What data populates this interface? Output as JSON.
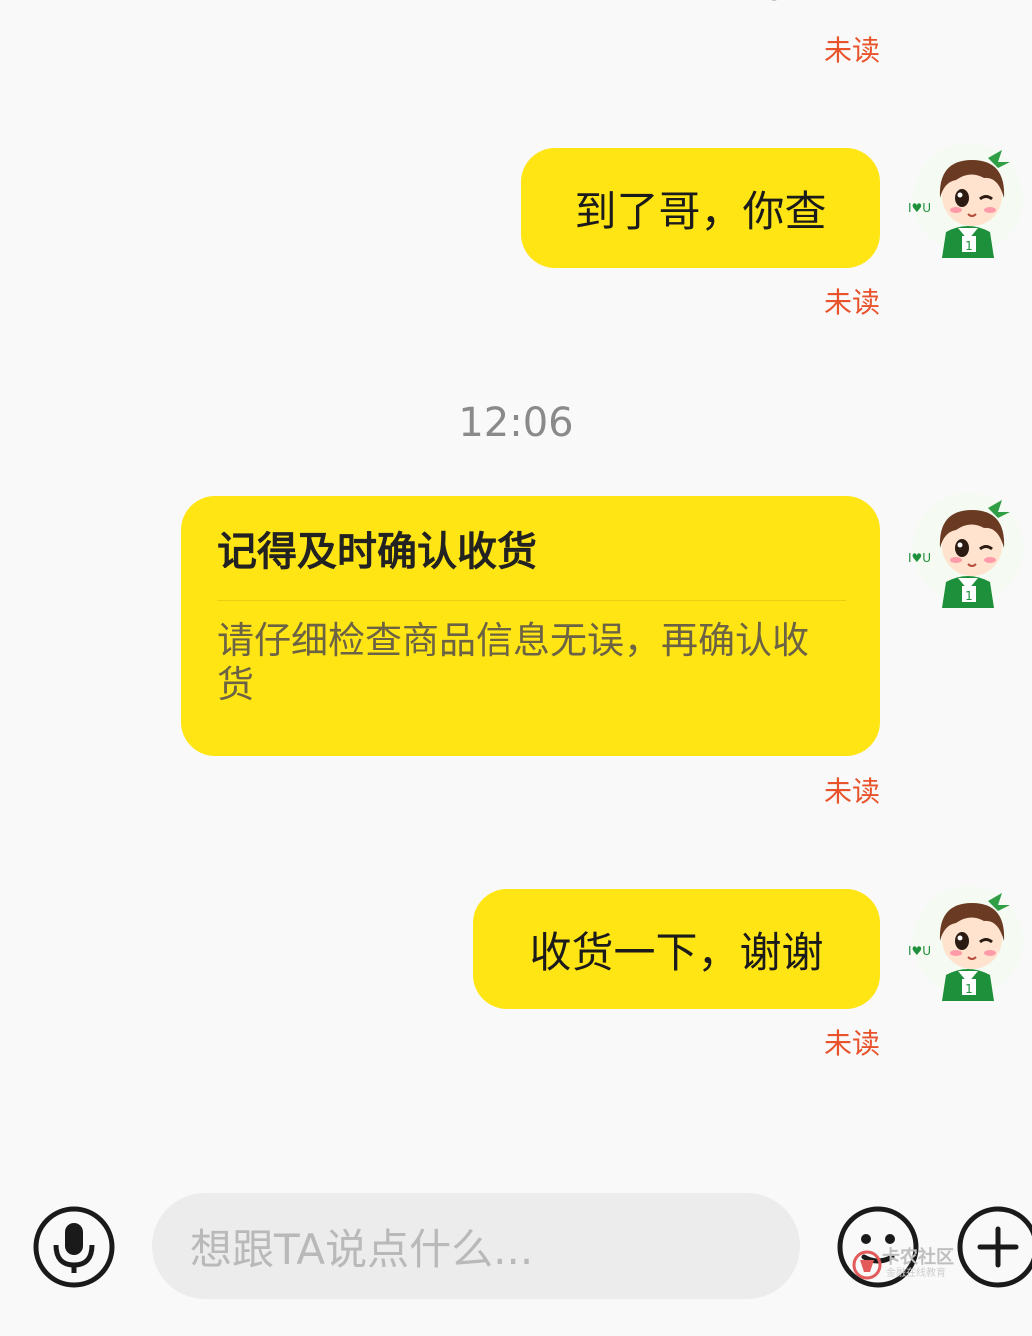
{
  "messages": [
    {
      "text": "到了哥，你查",
      "status": "未读"
    },
    {
      "card_title": "记得及时确认收货",
      "card_body": "请仔细检查商品信息无误，再确认收货",
      "status": "未读"
    },
    {
      "text": "收货一下，谢谢",
      "status": "未读"
    }
  ],
  "previous_status": "未读",
  "timestamp": "12:06",
  "avatar_text": "I♥U",
  "avatar_number": "1",
  "input": {
    "placeholder": "想跟TA说点什么..."
  },
  "watermark": {
    "title": "卡农社区",
    "subtitle": "金融在线教育"
  },
  "colors": {
    "bubble": "#ffe514",
    "unread": "#e8532c",
    "avatar_shirt": "#1e8f3a",
    "background": "#f9f9f9"
  }
}
